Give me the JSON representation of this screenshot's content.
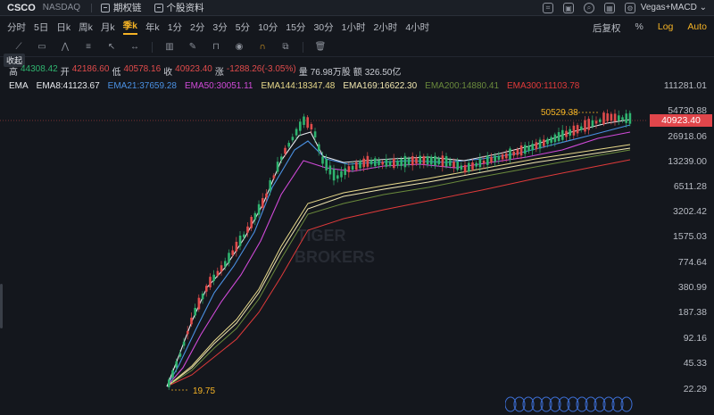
{
  "topbar": {
    "symbol": "CSCO",
    "exchange": "NASDAQ",
    "link1": "期权链",
    "link2": "个股资料",
    "indicator_select": "Vegas+MACD"
  },
  "periods": [
    "分时",
    "5日",
    "日k",
    "周k",
    "月k",
    "季k",
    "年k",
    "1分",
    "2分",
    "3分",
    "5分",
    "10分",
    "15分",
    "30分",
    "1小时",
    "2小时",
    "4小时"
  ],
  "active_period": "季k",
  "options": {
    "adjust": "后复权",
    "pct": "%",
    "log": "Log",
    "auto": "Auto"
  },
  "collapse_label": "收起",
  "ohlc": {
    "high_label": "高",
    "high": "44308.42",
    "open_label": "开",
    "open": "42186.60",
    "low_label": "低",
    "low": "40578.16",
    "close_label": "收",
    "close": "40923.40",
    "change_label": "涨",
    "change": "-1288.26(-3.05%)",
    "vol_label": "量",
    "vol": "76.98万股",
    "amt_label": "额",
    "amt": "326.50亿"
  },
  "ema": {
    "title": "EMA",
    "items": [
      {
        "label": "EMA8:41123.67",
        "color": "#e6e8ec"
      },
      {
        "label": "EMA21:37659.28",
        "color": "#4a90e2"
      },
      {
        "label": "EMA50:30051.11",
        "color": "#d04ad8"
      },
      {
        "label": "EMA144:18347.48",
        "color": "#e8d98a"
      },
      {
        "label": "EMA169:16622.30",
        "color": "#f0e6b0"
      },
      {
        "label": "EMA200:14880.41",
        "color": "#6a8a3c"
      },
      {
        "label": "EMA300:11103.78",
        "color": "#e03a3a"
      }
    ]
  },
  "axis": {
    "labels": [
      "111281.01",
      "54730.88",
      "26918.06",
      "13239.00",
      "6511.28",
      "3202.42",
      "1575.03",
      "774.64",
      "380.99",
      "187.38",
      "92.16",
      "45.33",
      "22.29"
    ],
    "current_price": "40923.40"
  },
  "annotations": {
    "max_label": "50529.38",
    "min_label": "19.75"
  },
  "watermark": {
    "line1": "TIGER",
    "line2": "BROKERS"
  },
  "colors": {
    "up": "#2fb36f",
    "down": "#e04b4b",
    "accent": "#f5b325",
    "bg": "#14171d"
  }
}
